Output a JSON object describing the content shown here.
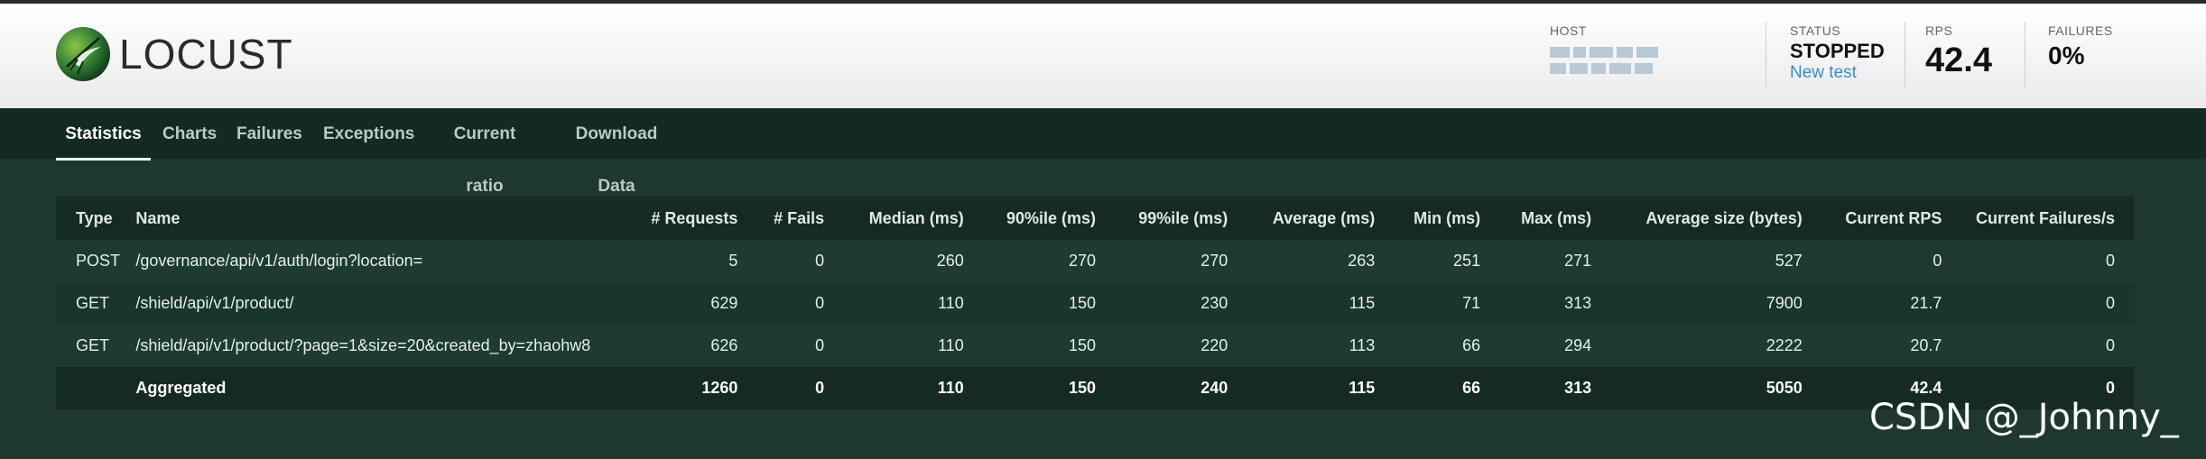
{
  "header": {
    "logo_text": "LOCUST",
    "host_label": "HOST",
    "status_label": "STATUS",
    "status_value": "STOPPED",
    "new_test_label": "New test",
    "rps_label": "RPS",
    "rps_value": "42.4",
    "failures_label": "FAILURES",
    "failures_value": "0%"
  },
  "nav": {
    "tabs": [
      {
        "label": "Statistics",
        "active": true
      },
      {
        "label": "Charts"
      },
      {
        "label": "Failures"
      },
      {
        "label": "Exceptions"
      },
      {
        "label": "Current ratio"
      },
      {
        "label": "Download Data"
      }
    ]
  },
  "table": {
    "columns": [
      "Type",
      "Name",
      "# Requests",
      "# Fails",
      "Median (ms)",
      "90%ile (ms)",
      "99%ile (ms)",
      "Average (ms)",
      "Min (ms)",
      "Max (ms)",
      "Average size (bytes)",
      "Current RPS",
      "Current Failures/s"
    ],
    "rows": [
      [
        "POST",
        "/governance/api/v1/auth/login?location=",
        "5",
        "0",
        "260",
        "270",
        "270",
        "263",
        "251",
        "271",
        "527",
        "0",
        "0"
      ],
      [
        "GET",
        "/shield/api/v1/product/",
        "629",
        "0",
        "110",
        "150",
        "230",
        "115",
        "71",
        "313",
        "7900",
        "21.7",
        "0"
      ],
      [
        "GET",
        "/shield/api/v1/product/?page=1&size=20&created_by=zhaohw8",
        "626",
        "0",
        "110",
        "150",
        "220",
        "113",
        "66",
        "294",
        "2222",
        "20.7",
        "0"
      ]
    ],
    "aggregated": [
      "",
      "Aggregated",
      "1260",
      "0",
      "110",
      "150",
      "240",
      "115",
      "66",
      "313",
      "5050",
      "42.4",
      "0"
    ]
  },
  "watermark": "CSDN @_Johnny_",
  "colors": {
    "background": "#1e382f",
    "nav": "#132a22",
    "link": "#3a8dc6"
  }
}
